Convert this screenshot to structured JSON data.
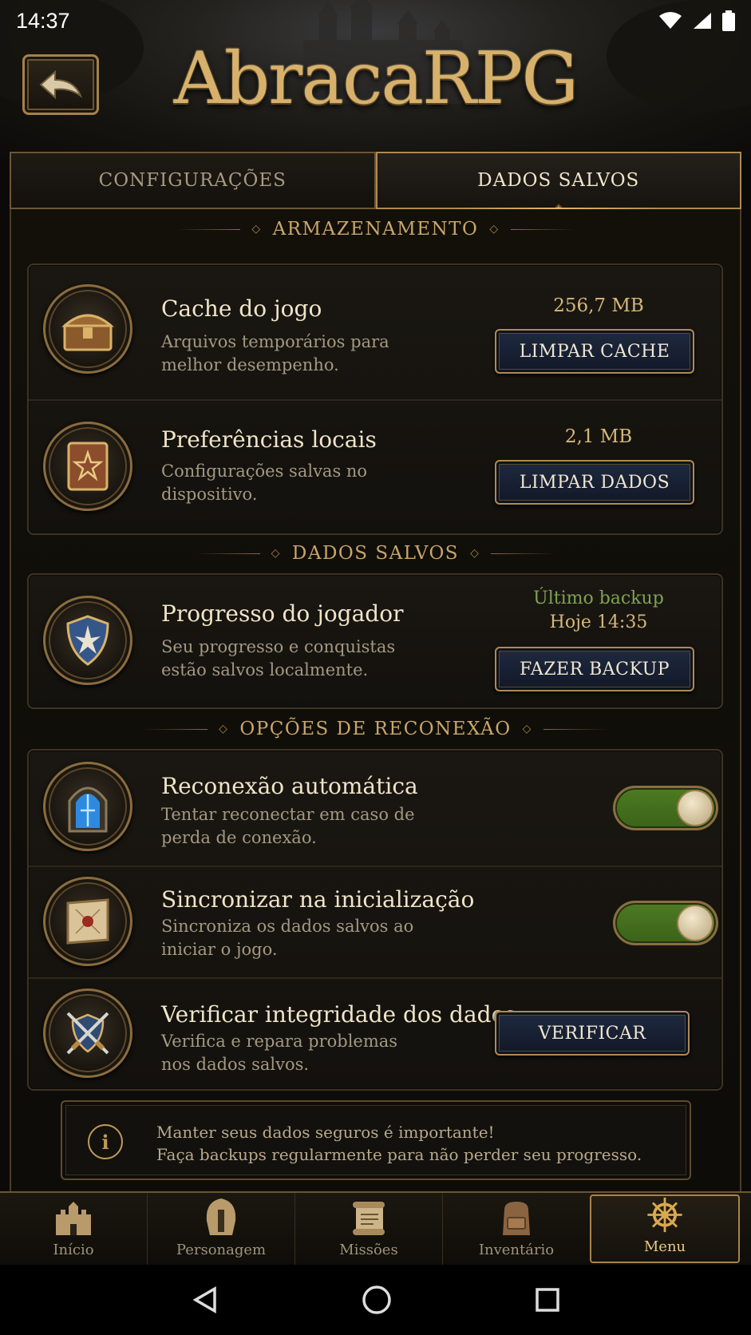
{
  "status_bar": {
    "time": "14:37"
  },
  "app": {
    "title": "AbracaRPG"
  },
  "tabs": [
    {
      "label": "CONFIGURAÇÕES",
      "active": false
    },
    {
      "label": "DADOS SALVOS",
      "active": true
    }
  ],
  "sections": {
    "storage": "ARMAZENAMENTO",
    "saved": "DADOS SALVOS",
    "reconnect": "OPÇÕES DE RECONEXÃO"
  },
  "storage": {
    "cache": {
      "title": "Cache do jogo",
      "desc": "Arquivos temporários para melhor desempenho.",
      "size": "256,7 MB",
      "button": "LIMPAR CACHE"
    },
    "prefs": {
      "title": "Preferências locais",
      "desc": "Configurações salvas no dispositivo.",
      "size": "2,1 MB",
      "button": "LIMPAR DADOS"
    }
  },
  "saved": {
    "progress": {
      "title": "Progresso do jogador",
      "desc": "Seu progresso e conquistas estão salvos localmente.",
      "backup_label": "Último backup",
      "backup_time": "Hoje 14:35",
      "button": "FAZER BACKUP"
    }
  },
  "reconnect": {
    "auto": {
      "title": "Reconexão automática",
      "desc": "Tentar reconectar em caso de perda de conexão.",
      "enabled": true
    },
    "sync": {
      "title": "Sincronizar na inicialização",
      "desc": "Sincroniza os dados salvos ao iniciar o jogo.",
      "enabled": true
    },
    "verify": {
      "title": "Verificar integridade dos dados",
      "desc": "Verifica e repara problemas nos dados salvos.",
      "button": "VERIFICAR"
    }
  },
  "info": {
    "line1": "Manter seus dados seguros é importante!",
    "line2": "Faça backups regularmente para não perder seu progresso."
  },
  "bottom_nav": [
    {
      "label": "Início",
      "icon": "castle-icon",
      "active": false
    },
    {
      "label": "Personagem",
      "icon": "helmet-icon",
      "active": false
    },
    {
      "label": "Missões",
      "icon": "scroll-icon",
      "active": false
    },
    {
      "label": "Inventário",
      "icon": "backpack-icon",
      "active": false
    },
    {
      "label": "Menu",
      "icon": "ship-wheel-icon",
      "active": true
    }
  ],
  "colors": {
    "gold": "#c9a66a",
    "toggle_on": "#4d7a23",
    "button_bg": "#1f2a40",
    "backup_green": "#7ea352"
  }
}
